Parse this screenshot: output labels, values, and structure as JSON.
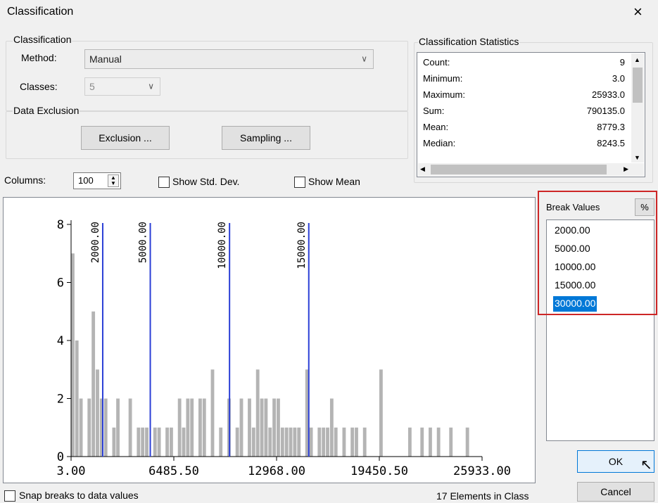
{
  "window": {
    "title": "Classification",
    "close_glyph": "×"
  },
  "classification": {
    "legend": "Classification",
    "method_label": "Method:",
    "method_value": "Manual",
    "classes_label": "Classes:",
    "classes_value": "5"
  },
  "exclusion": {
    "legend": "Data Exclusion",
    "exclusion_button": "Exclusion ...",
    "sampling_button": "Sampling ..."
  },
  "statistics": {
    "legend": "Classification Statistics",
    "rows": [
      {
        "label": "Count:",
        "value": "9"
      },
      {
        "label": "Minimum:",
        "value": "3.0"
      },
      {
        "label": "Maximum:",
        "value": "25933.0"
      },
      {
        "label": "Sum:",
        "value": "790135.0"
      },
      {
        "label": "Mean:",
        "value": "8779.3"
      },
      {
        "label": "Median:",
        "value": "8243.5"
      }
    ]
  },
  "columns": {
    "label": "Columns:",
    "value": "100"
  },
  "options": {
    "show_std_dev": "Show Std. Dev.",
    "show_mean": "Show Mean",
    "snap_breaks": "Snap breaks to data values"
  },
  "break_values": {
    "header": "Break Values",
    "percent_button": "%",
    "items": [
      "2000.00",
      "5000.00",
      "10000.00",
      "15000.00",
      "30000.00"
    ],
    "selected_index": 4
  },
  "status": {
    "elements_in_class": "17 Elements in Class"
  },
  "buttons": {
    "ok": "OK",
    "cancel": "Cancel"
  },
  "colors": {
    "bars": "#b4b4b4",
    "break_lines": "#2b3fd6",
    "selection": "#0078d7",
    "highlight_box": "#cd2626"
  },
  "chart_data": {
    "type": "bar",
    "title": "",
    "xlabel": "",
    "ylabel": "",
    "xlim": [
      3.0,
      25933.0
    ],
    "ylim": [
      0,
      8
    ],
    "x_ticks": [
      "3.00",
      "6485.50",
      "12968.00",
      "19450.50",
      "25933.00"
    ],
    "y_ticks": [
      "0",
      "2",
      "4",
      "6",
      "8"
    ],
    "bin_count": 100,
    "bins": [
      {
        "x": 3,
        "count": 7
      },
      {
        "x": 260,
        "count": 4
      },
      {
        "x": 520,
        "count": 2
      },
      {
        "x": 1040,
        "count": 2
      },
      {
        "x": 1300,
        "count": 5
      },
      {
        "x": 1560,
        "count": 3
      },
      {
        "x": 1820,
        "count": 2
      },
      {
        "x": 2080,
        "count": 2
      },
      {
        "x": 2600,
        "count": 1
      },
      {
        "x": 2850,
        "count": 2
      },
      {
        "x": 3630,
        "count": 2
      },
      {
        "x": 4150,
        "count": 1
      },
      {
        "x": 4410,
        "count": 1
      },
      {
        "x": 4670,
        "count": 1
      },
      {
        "x": 5190,
        "count": 1
      },
      {
        "x": 5450,
        "count": 1
      },
      {
        "x": 5960,
        "count": 1
      },
      {
        "x": 6220,
        "count": 1
      },
      {
        "x": 6740,
        "count": 2
      },
      {
        "x": 7000,
        "count": 1
      },
      {
        "x": 7260,
        "count": 2
      },
      {
        "x": 7520,
        "count": 2
      },
      {
        "x": 8040,
        "count": 2
      },
      {
        "x": 8300,
        "count": 2
      },
      {
        "x": 8820,
        "count": 3
      },
      {
        "x": 9340,
        "count": 1
      },
      {
        "x": 9860,
        "count": 2
      },
      {
        "x": 10380,
        "count": 1
      },
      {
        "x": 10640,
        "count": 2
      },
      {
        "x": 11150,
        "count": 2
      },
      {
        "x": 11410,
        "count": 1
      },
      {
        "x": 11670,
        "count": 3
      },
      {
        "x": 11930,
        "count": 2
      },
      {
        "x": 12190,
        "count": 2
      },
      {
        "x": 12450,
        "count": 1
      },
      {
        "x": 12710,
        "count": 2
      },
      {
        "x": 12970,
        "count": 2
      },
      {
        "x": 13230,
        "count": 1
      },
      {
        "x": 13490,
        "count": 1
      },
      {
        "x": 13750,
        "count": 1
      },
      {
        "x": 14010,
        "count": 1
      },
      {
        "x": 14270,
        "count": 1
      },
      {
        "x": 14780,
        "count": 3
      },
      {
        "x": 15040,
        "count": 1
      },
      {
        "x": 15560,
        "count": 1
      },
      {
        "x": 15820,
        "count": 1
      },
      {
        "x": 16080,
        "count": 1
      },
      {
        "x": 16340,
        "count": 2
      },
      {
        "x": 16600,
        "count": 1
      },
      {
        "x": 17120,
        "count": 1
      },
      {
        "x": 17640,
        "count": 1
      },
      {
        "x": 17900,
        "count": 1
      },
      {
        "x": 18420,
        "count": 1
      },
      {
        "x": 19450,
        "count": 3
      },
      {
        "x": 21270,
        "count": 1
      },
      {
        "x": 22040,
        "count": 1
      },
      {
        "x": 22560,
        "count": 1
      },
      {
        "x": 23080,
        "count": 1
      },
      {
        "x": 23860,
        "count": 1
      },
      {
        "x": 24900,
        "count": 1
      }
    ],
    "break_lines": [
      2000,
      5000,
      10000,
      15000
    ],
    "break_labels": [
      "2000.00",
      "5000.00",
      "10000.00",
      "15000.00"
    ]
  }
}
